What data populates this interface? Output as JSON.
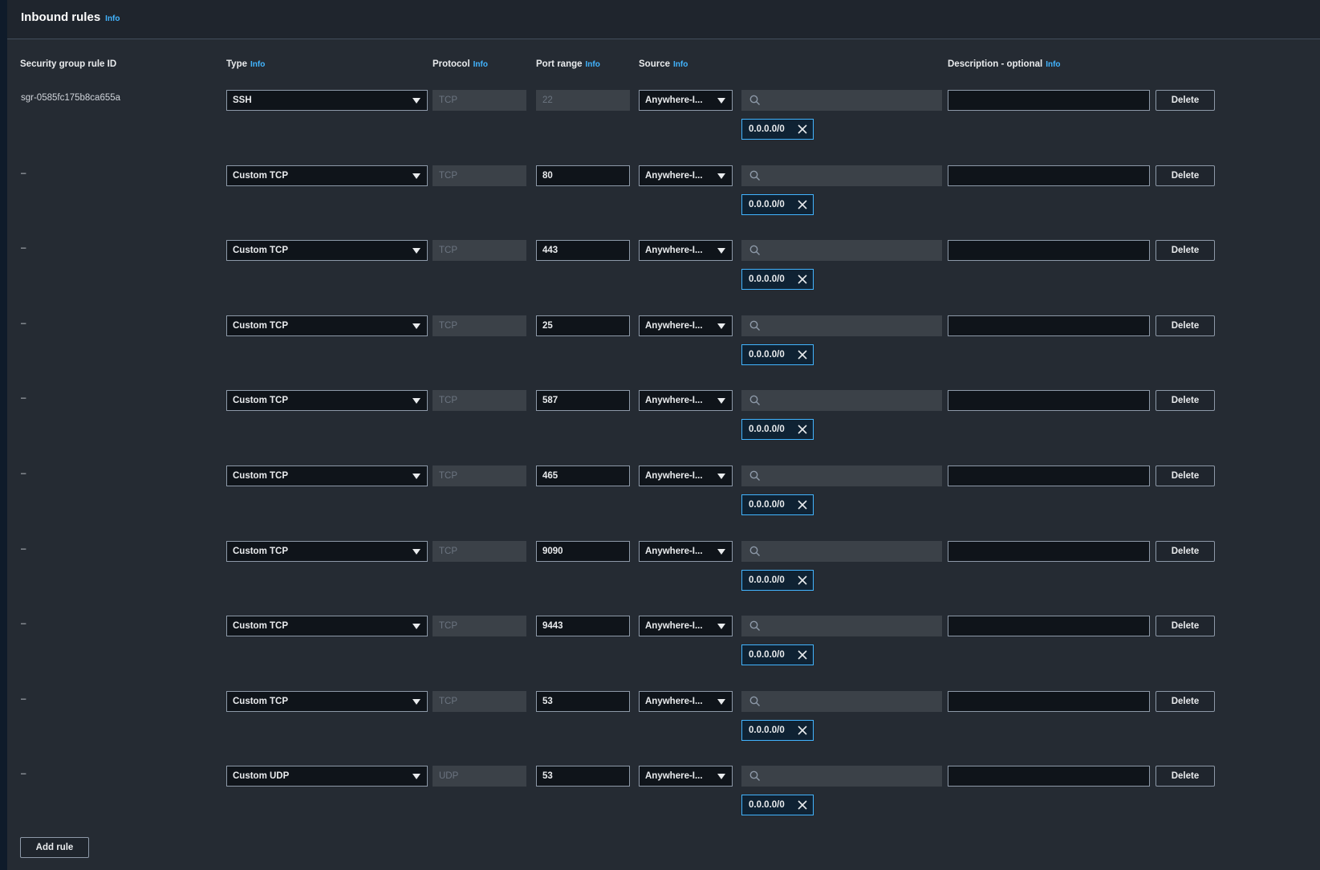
{
  "header": {
    "title": "Inbound rules",
    "info": "Info"
  },
  "columns": {
    "rule_id": "Security group rule ID",
    "type": "Type",
    "protocol": "Protocol",
    "port_range": "Port range",
    "source": "Source",
    "description": "Description - optional",
    "info": "Info"
  },
  "rules": [
    {
      "id": "sgr-0585fc175b8ca655a",
      "type": "SSH",
      "protocol": "TCP",
      "port": "22",
      "port_disabled": true,
      "source": "Anywhere-I...",
      "search": "",
      "cidr": "0.0.0.0/0",
      "description": "",
      "delete": "Delete"
    },
    {
      "id": "–",
      "type": "Custom TCP",
      "protocol": "TCP",
      "port": "80",
      "port_disabled": false,
      "source": "Anywhere-I...",
      "search": "",
      "cidr": "0.0.0.0/0",
      "description": "",
      "delete": "Delete"
    },
    {
      "id": "–",
      "type": "Custom TCP",
      "protocol": "TCP",
      "port": "443",
      "port_disabled": false,
      "source": "Anywhere-I...",
      "search": "",
      "cidr": "0.0.0.0/0",
      "description": "",
      "delete": "Delete"
    },
    {
      "id": "–",
      "type": "Custom TCP",
      "protocol": "TCP",
      "port": "25",
      "port_disabled": false,
      "source": "Anywhere-I...",
      "search": "",
      "cidr": "0.0.0.0/0",
      "description": "",
      "delete": "Delete"
    },
    {
      "id": "–",
      "type": "Custom TCP",
      "protocol": "TCP",
      "port": "587",
      "port_disabled": false,
      "source": "Anywhere-I...",
      "search": "",
      "cidr": "0.0.0.0/0",
      "description": "",
      "delete": "Delete"
    },
    {
      "id": "–",
      "type": "Custom TCP",
      "protocol": "TCP",
      "port": "465",
      "port_disabled": false,
      "source": "Anywhere-I...",
      "search": "",
      "cidr": "0.0.0.0/0",
      "description": "",
      "delete": "Delete"
    },
    {
      "id": "–",
      "type": "Custom TCP",
      "protocol": "TCP",
      "port": "9090",
      "port_disabled": false,
      "source": "Anywhere-I...",
      "search": "",
      "cidr": "0.0.0.0/0",
      "description": "",
      "delete": "Delete"
    },
    {
      "id": "–",
      "type": "Custom TCP",
      "protocol": "TCP",
      "port": "9443",
      "port_disabled": false,
      "source": "Anywhere-I...",
      "search": "",
      "cidr": "0.0.0.0/0",
      "description": "",
      "delete": "Delete"
    },
    {
      "id": "–",
      "type": "Custom TCP",
      "protocol": "TCP",
      "port": "53",
      "port_disabled": false,
      "source": "Anywhere-I...",
      "search": "",
      "cidr": "0.0.0.0/0",
      "description": "",
      "delete": "Delete"
    },
    {
      "id": "–",
      "type": "Custom UDP",
      "protocol": "UDP",
      "port": "53",
      "port_disabled": false,
      "source": "Anywhere-I...",
      "search": "",
      "cidr": "0.0.0.0/0",
      "description": "",
      "delete": "Delete"
    }
  ],
  "footer": {
    "add_rule": "Add rule"
  },
  "colors": {
    "accent": "#42b4ff",
    "panel": "#252b33",
    "border": "#8d99a8"
  },
  "icons": {
    "caret": "caret-down-icon",
    "search": "search-icon",
    "remove": "close-icon"
  }
}
